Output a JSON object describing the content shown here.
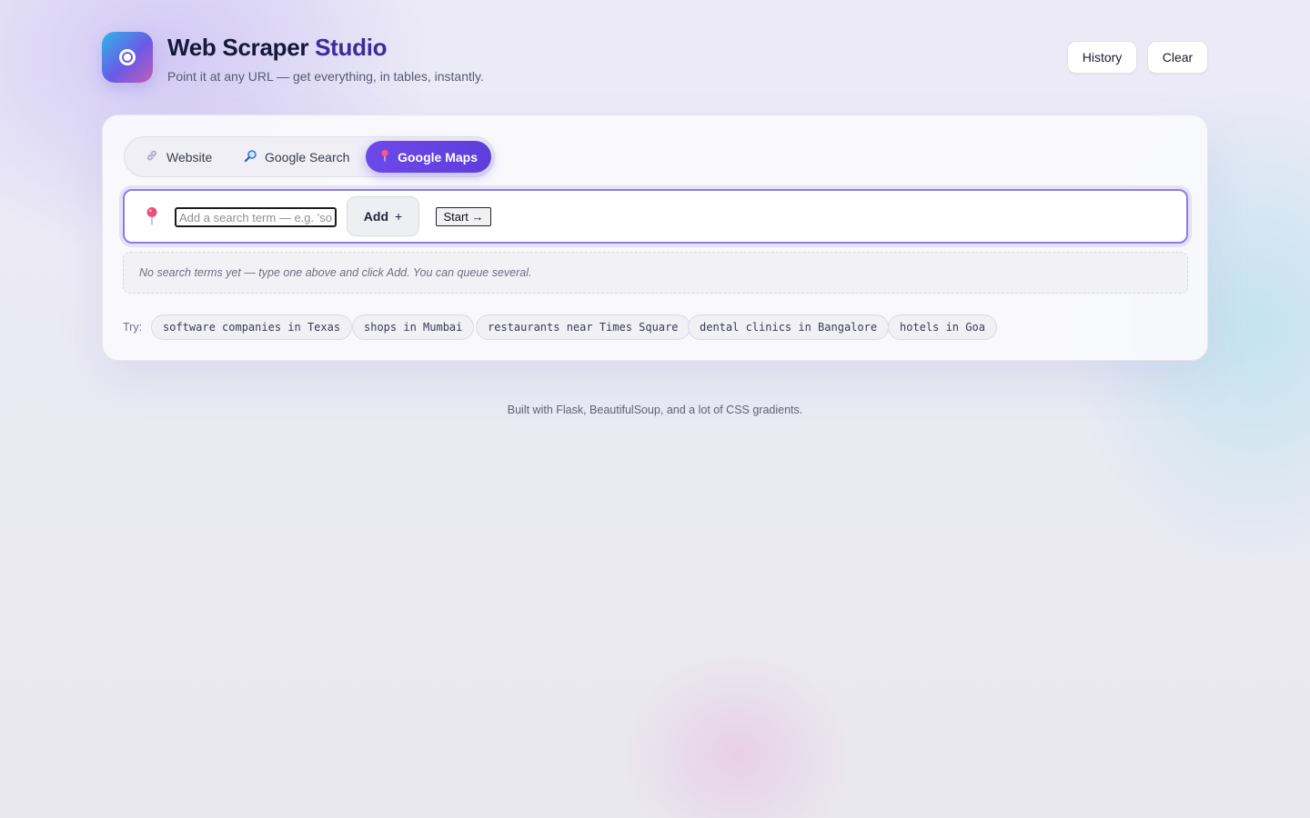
{
  "header": {
    "title_main": "Web Scraper",
    "title_accent": "Studio",
    "subtitle": "Point it at any URL — get everything, in tables, instantly.",
    "history_label": "History",
    "clear_label": "Clear",
    "logo_icon": "target-icon"
  },
  "tabs": [
    {
      "label": "Website",
      "icon": "link-icon",
      "active": false
    },
    {
      "label": "Google Search",
      "icon": "magnifier-icon",
      "active": false
    },
    {
      "label": "Google Maps",
      "icon": "map-pin-icon",
      "active": true
    }
  ],
  "search": {
    "placeholder": "Add a search term — e.g. 'software companies in Texas'",
    "value": "",
    "add_label": "Add",
    "add_icon": "+",
    "start_label": "Start →"
  },
  "empty_state": "No search terms yet — type one above and click Add. You can queue several.",
  "suggestions": {
    "label": "Try:",
    "chips": [
      "software companies in Texas",
      "shops in Mumbai",
      "restaurants near Times Square",
      "dental clinics in Bangalore",
      "hotels in Goa"
    ]
  },
  "footer": "Built with Flask, BeautifulSoup, and a lot of CSS gradients.",
  "colors": {
    "accent": "#6c49e8",
    "title_accent": "#3e2b9a",
    "pin": "#e8507a"
  }
}
